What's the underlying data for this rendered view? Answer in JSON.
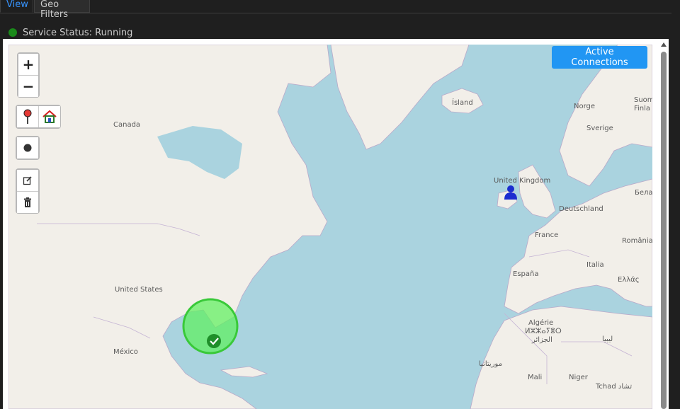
{
  "tabs": [
    {
      "label": "View",
      "active": true
    },
    {
      "label": "Geo Filters",
      "active": false
    }
  ],
  "status": {
    "text": "Service Status: Running",
    "color": "#1a8a1a"
  },
  "map": {
    "button_active_connections": "Active Connections",
    "zoom_in": "+",
    "zoom_out": "−",
    "labels": {
      "canada": "Canada",
      "united_states": "United States",
      "mexico": "México",
      "island": "Ísland",
      "norge": "Norge",
      "sverige": "Sverige",
      "suomi": "Suom",
      "finland": "Finla",
      "united_kingdom": "United Kingdom",
      "deutschland": "Deutschland",
      "france": "France",
      "espana": "España",
      "italia": "Italia",
      "romania": "România",
      "belarus": "Бела",
      "ellada": "Ελλάς",
      "algerie1": "Algérie",
      "algerie2": "ⵍⵣⵣⴰⵢⴻⵔ",
      "algerie3": "الجزائر",
      "libya": "ليبيا",
      "mauritania": "موريتانيا",
      "mali": "Mali",
      "niger": "Niger",
      "tchad": "Tchad تشاد"
    },
    "colors": {
      "ocean": "#aad3df",
      "land": "#f2efe9",
      "accent": "#2196f3",
      "region_fill": "#5ef05e"
    }
  }
}
